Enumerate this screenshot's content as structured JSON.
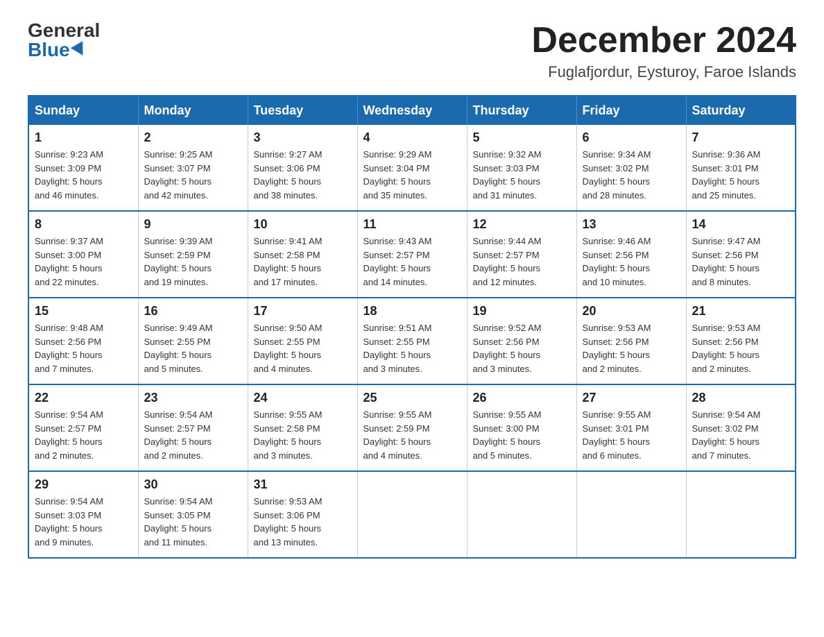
{
  "logo": {
    "general": "General",
    "blue": "Blue"
  },
  "header": {
    "month": "December 2024",
    "location": "Fuglafjordur, Eysturoy, Faroe Islands"
  },
  "days_of_week": [
    "Sunday",
    "Monday",
    "Tuesday",
    "Wednesday",
    "Thursday",
    "Friday",
    "Saturday"
  ],
  "weeks": [
    [
      {
        "day": "1",
        "sunrise": "9:23 AM",
        "sunset": "3:09 PM",
        "daylight": "5 hours and 46 minutes."
      },
      {
        "day": "2",
        "sunrise": "9:25 AM",
        "sunset": "3:07 PM",
        "daylight": "5 hours and 42 minutes."
      },
      {
        "day": "3",
        "sunrise": "9:27 AM",
        "sunset": "3:06 PM",
        "daylight": "5 hours and 38 minutes."
      },
      {
        "day": "4",
        "sunrise": "9:29 AM",
        "sunset": "3:04 PM",
        "daylight": "5 hours and 35 minutes."
      },
      {
        "day": "5",
        "sunrise": "9:32 AM",
        "sunset": "3:03 PM",
        "daylight": "5 hours and 31 minutes."
      },
      {
        "day": "6",
        "sunrise": "9:34 AM",
        "sunset": "3:02 PM",
        "daylight": "5 hours and 28 minutes."
      },
      {
        "day": "7",
        "sunrise": "9:36 AM",
        "sunset": "3:01 PM",
        "daylight": "5 hours and 25 minutes."
      }
    ],
    [
      {
        "day": "8",
        "sunrise": "9:37 AM",
        "sunset": "3:00 PM",
        "daylight": "5 hours and 22 minutes."
      },
      {
        "day": "9",
        "sunrise": "9:39 AM",
        "sunset": "2:59 PM",
        "daylight": "5 hours and 19 minutes."
      },
      {
        "day": "10",
        "sunrise": "9:41 AM",
        "sunset": "2:58 PM",
        "daylight": "5 hours and 17 minutes."
      },
      {
        "day": "11",
        "sunrise": "9:43 AM",
        "sunset": "2:57 PM",
        "daylight": "5 hours and 14 minutes."
      },
      {
        "day": "12",
        "sunrise": "9:44 AM",
        "sunset": "2:57 PM",
        "daylight": "5 hours and 12 minutes."
      },
      {
        "day": "13",
        "sunrise": "9:46 AM",
        "sunset": "2:56 PM",
        "daylight": "5 hours and 10 minutes."
      },
      {
        "day": "14",
        "sunrise": "9:47 AM",
        "sunset": "2:56 PM",
        "daylight": "5 hours and 8 minutes."
      }
    ],
    [
      {
        "day": "15",
        "sunrise": "9:48 AM",
        "sunset": "2:56 PM",
        "daylight": "5 hours and 7 minutes."
      },
      {
        "day": "16",
        "sunrise": "9:49 AM",
        "sunset": "2:55 PM",
        "daylight": "5 hours and 5 minutes."
      },
      {
        "day": "17",
        "sunrise": "9:50 AM",
        "sunset": "2:55 PM",
        "daylight": "5 hours and 4 minutes."
      },
      {
        "day": "18",
        "sunrise": "9:51 AM",
        "sunset": "2:55 PM",
        "daylight": "5 hours and 3 minutes."
      },
      {
        "day": "19",
        "sunrise": "9:52 AM",
        "sunset": "2:56 PM",
        "daylight": "5 hours and 3 minutes."
      },
      {
        "day": "20",
        "sunrise": "9:53 AM",
        "sunset": "2:56 PM",
        "daylight": "5 hours and 2 minutes."
      },
      {
        "day": "21",
        "sunrise": "9:53 AM",
        "sunset": "2:56 PM",
        "daylight": "5 hours and 2 minutes."
      }
    ],
    [
      {
        "day": "22",
        "sunrise": "9:54 AM",
        "sunset": "2:57 PM",
        "daylight": "5 hours and 2 minutes."
      },
      {
        "day": "23",
        "sunrise": "9:54 AM",
        "sunset": "2:57 PM",
        "daylight": "5 hours and 2 minutes."
      },
      {
        "day": "24",
        "sunrise": "9:55 AM",
        "sunset": "2:58 PM",
        "daylight": "5 hours and 3 minutes."
      },
      {
        "day": "25",
        "sunrise": "9:55 AM",
        "sunset": "2:59 PM",
        "daylight": "5 hours and 4 minutes."
      },
      {
        "day": "26",
        "sunrise": "9:55 AM",
        "sunset": "3:00 PM",
        "daylight": "5 hours and 5 minutes."
      },
      {
        "day": "27",
        "sunrise": "9:55 AM",
        "sunset": "3:01 PM",
        "daylight": "5 hours and 6 minutes."
      },
      {
        "day": "28",
        "sunrise": "9:54 AM",
        "sunset": "3:02 PM",
        "daylight": "5 hours and 7 minutes."
      }
    ],
    [
      {
        "day": "29",
        "sunrise": "9:54 AM",
        "sunset": "3:03 PM",
        "daylight": "5 hours and 9 minutes."
      },
      {
        "day": "30",
        "sunrise": "9:54 AM",
        "sunset": "3:05 PM",
        "daylight": "5 hours and 11 minutes."
      },
      {
        "day": "31",
        "sunrise": "9:53 AM",
        "sunset": "3:06 PM",
        "daylight": "5 hours and 13 minutes."
      },
      null,
      null,
      null,
      null
    ]
  ],
  "labels": {
    "sunrise": "Sunrise:",
    "sunset": "Sunset:",
    "daylight": "Daylight:"
  }
}
